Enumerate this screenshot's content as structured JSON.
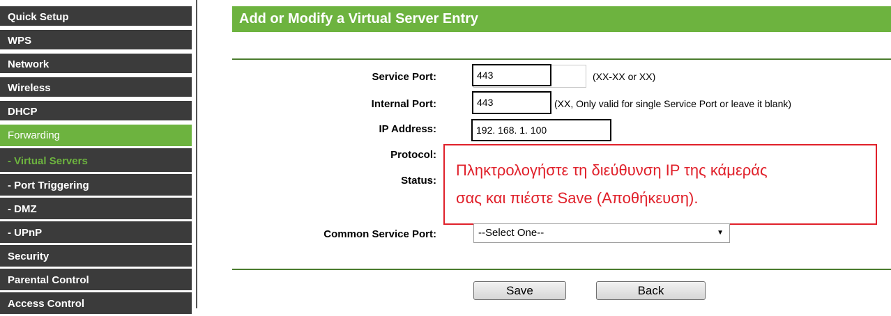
{
  "sidebar": {
    "items": [
      {
        "label": "Quick Setup"
      },
      {
        "label": "WPS"
      },
      {
        "label": "Network"
      },
      {
        "label": "Wireless"
      },
      {
        "label": "DHCP"
      },
      {
        "label": "Forwarding"
      },
      {
        "label": "- Virtual Servers"
      },
      {
        "label": "- Port Triggering"
      },
      {
        "label": "- DMZ"
      },
      {
        "label": "- UPnP"
      },
      {
        "label": "Security"
      },
      {
        "label": "Parental Control"
      },
      {
        "label": "Access Control"
      }
    ],
    "active_color": "#6db33f",
    "item_color": "#3b3b3b"
  },
  "header": {
    "title": "Add or Modify a Virtual Server Entry"
  },
  "form": {
    "service_port": {
      "label": "Service Port:",
      "value": "443",
      "hint": "(XX-XX or XX)"
    },
    "internal_port": {
      "label": "Internal Port:",
      "value": "443",
      "hint": "(XX, Only valid for single Service Port or leave it blank)"
    },
    "ip_address": {
      "label": "IP Address:",
      "value": "192. 168. 1. 100"
    },
    "protocol": {
      "label": "Protocol:"
    },
    "status": {
      "label": "Status:"
    },
    "common_service_port": {
      "label": "Common Service Port:",
      "selected": "--Select One--"
    }
  },
  "callout": {
    "line1": "Πληκτρολογήστε τη διεύθυνση IP της κάμεράς",
    "line2": "σας και πιέστε Save (Αποθήκευση).",
    "color": "#e0202a"
  },
  "buttons": {
    "save": "Save",
    "back": "Back"
  }
}
